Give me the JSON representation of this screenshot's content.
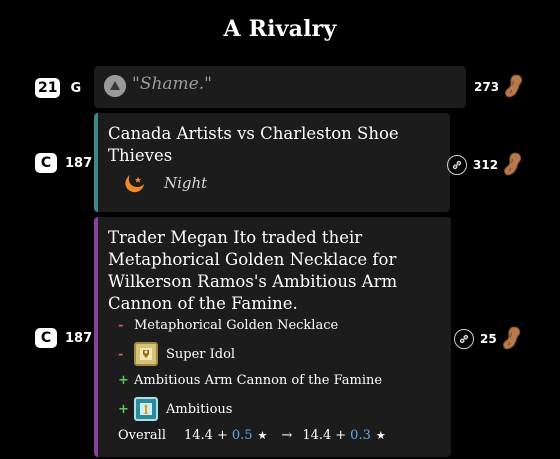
{
  "page": {
    "title": "A Rivalry"
  },
  "rows": [
    {
      "badge": "21",
      "left_label": "G",
      "quote": "\"Shame.\"",
      "count": "273"
    },
    {
      "badge": "C",
      "left_label": "187",
      "game_title": "Canada Artists vs Charleston Shoe Thieves",
      "weather": "Night",
      "count": "312"
    },
    {
      "badge": "C",
      "left_label": "187",
      "trade_title": "Trader Megan Ito traded their Metaphorical Golden Necklace for Wilkerson Ramos's Ambitious Arm Cannon of the Famine.",
      "changes": [
        {
          "sign": "-",
          "label": "Metaphorical Golden Necklace",
          "icon": "none"
        },
        {
          "sign": "-",
          "label": "Super Idol",
          "icon": "super-idol-icon"
        },
        {
          "sign": "+",
          "label": "Ambitious Arm Cannon of the Famine",
          "icon": "none"
        },
        {
          "sign": "+",
          "label": "Ambitious",
          "icon": "ambitious-icon"
        }
      ],
      "overall": {
        "label": "Overall",
        "before_base": "14.4",
        "before_plus": "+",
        "before_delta": "0.5",
        "arrow": "→",
        "after_base": "14.4",
        "after_plus": "+",
        "after_delta": "0.3",
        "star": "★"
      },
      "count": "25"
    }
  ],
  "colors": {
    "teal_bar": "#3e8a8a",
    "purple_bar": "#8a3f9e",
    "minus": "#e25b5b",
    "plus": "#5bc95b",
    "delta_blue": "#63a8ee"
  }
}
